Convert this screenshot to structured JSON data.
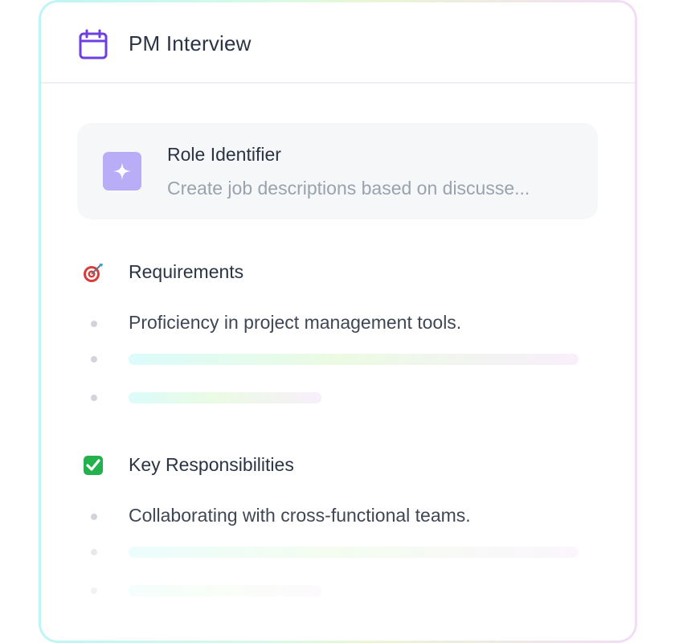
{
  "header": {
    "title": "PM Interview",
    "icon": "calendar-icon"
  },
  "role_card": {
    "icon": "sparkle-icon",
    "name": "Role Identifier",
    "description": "Create job descriptions based on discusse..."
  },
  "sections": [
    {
      "icon": "target-icon",
      "title": "Requirements",
      "items": [
        "Proficiency in project management tools."
      ]
    },
    {
      "icon": "check-mark-icon",
      "title": "Key Responsibilities",
      "items": [
        "Collaborating with cross-functional teams."
      ]
    }
  ],
  "colors": {
    "accent": "#6d3fe0",
    "badge": "#b9adf7",
    "check": "#22b14c"
  }
}
